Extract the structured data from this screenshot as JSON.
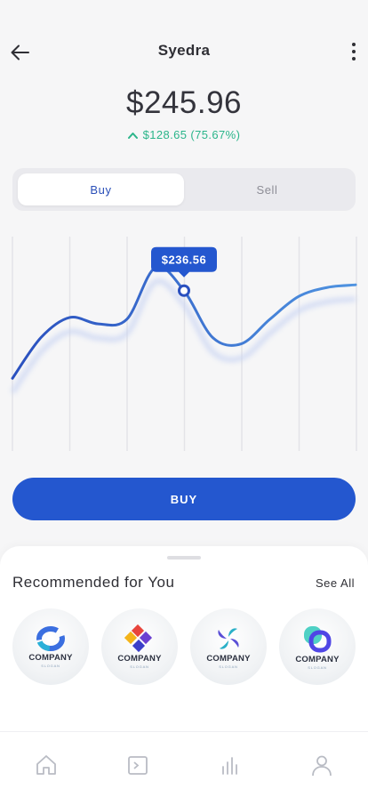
{
  "header": {
    "title": "Syedra"
  },
  "quote": {
    "price": "$245.96",
    "change": "$128.65 (75.67%)",
    "change_color": "#2bb58a"
  },
  "segment": {
    "tabs": [
      "Buy",
      "Sell"
    ],
    "active": "Buy"
  },
  "chart_data": {
    "type": "line",
    "title": "",
    "xlabel": "",
    "ylabel": "",
    "grid": "vertical",
    "x": [
      0,
      1,
      2,
      3,
      4,
      5,
      6,
      7,
      8,
      9,
      10,
      11,
      12
    ],
    "series": [
      {
        "values": [
          140,
          185,
          207,
          200,
          205,
          262,
          236.56,
          185,
          178,
          205,
          230,
          240,
          243
        ]
      }
    ],
    "highlight": {
      "x": 6,
      "label": "$236.56"
    },
    "ylim": [
      60,
      300
    ],
    "line_color": "#2457cf"
  },
  "buy_button": {
    "label": "BUY"
  },
  "recommendations": {
    "title": "Recommended for You",
    "see_all": "See All",
    "items": [
      {
        "name": "COMPANY",
        "slogan": "SLOGAN"
      },
      {
        "name": "COMPANY",
        "slogan": "SLOGAN"
      },
      {
        "name": "COMPANY",
        "slogan": "SLOGAN"
      },
      {
        "name": "COMPANY",
        "slogan": "SLOGAN"
      }
    ]
  },
  "nav": {
    "items": [
      "home-icon",
      "wallet-icon",
      "chart-icon",
      "profile-icon"
    ]
  },
  "colors": {
    "accent": "#2457cf",
    "positive": "#2bb58a",
    "background": "#f6f6f7"
  }
}
